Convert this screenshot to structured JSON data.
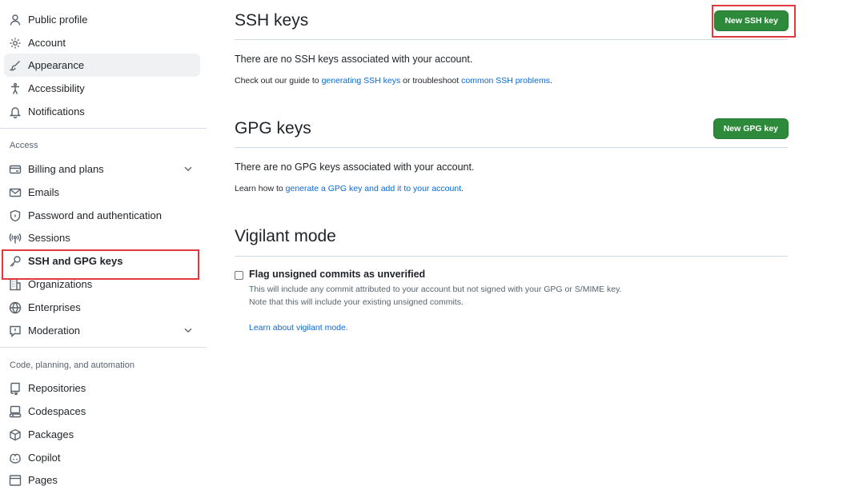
{
  "sidebar": {
    "items_top": [
      {
        "label": "Public profile",
        "icon": "person-icon"
      },
      {
        "label": "Account",
        "icon": "gear-icon"
      },
      {
        "label": "Appearance",
        "icon": "paintbrush-icon"
      },
      {
        "label": "Accessibility",
        "icon": "accessibility-icon"
      },
      {
        "label": "Notifications",
        "icon": "bell-icon"
      }
    ],
    "access_label": "Access",
    "items_access": [
      {
        "label": "Billing and plans",
        "icon": "credit-card-icon"
      },
      {
        "label": "Emails",
        "icon": "mail-icon"
      },
      {
        "label": "Password and authentication",
        "icon": "shield-lock-icon"
      },
      {
        "label": "Sessions",
        "icon": "broadcast-icon"
      },
      {
        "label": "SSH and GPG keys",
        "icon": "key-icon"
      },
      {
        "label": "Organizations",
        "icon": "organization-icon"
      },
      {
        "label": "Enterprises",
        "icon": "globe-icon"
      },
      {
        "label": "Moderation",
        "icon": "report-icon"
      }
    ],
    "code_label": "Code, planning, and automation",
    "items_code": [
      {
        "label": "Repositories",
        "icon": "repo-icon"
      },
      {
        "label": "Codespaces",
        "icon": "codespaces-icon"
      },
      {
        "label": "Packages",
        "icon": "package-icon"
      },
      {
        "label": "Copilot",
        "icon": "copilot-icon"
      },
      {
        "label": "Pages",
        "icon": "browser-icon"
      }
    ]
  },
  "ssh": {
    "title": "SSH keys",
    "button": "New SSH key",
    "empty": "There are no SSH keys associated with your account.",
    "guide_prefix": "Check out our guide to ",
    "guide_link1": "generating SSH keys",
    "guide_mid": " or troubleshoot ",
    "guide_link2": "common SSH problems",
    "guide_suffix": "."
  },
  "gpg": {
    "title": "GPG keys",
    "button": "New GPG key",
    "empty": "There are no GPG keys associated with your account.",
    "learn_prefix": "Learn how to ",
    "learn_link": "generate a GPG key and add it to your account",
    "learn_suffix": "."
  },
  "vigilant": {
    "title": "Vigilant mode",
    "checkbox_label": "Flag unsigned commits as unverified",
    "note1": "This will include any commit attributed to your account but not signed with your GPG or S/MIME key.",
    "note2": "Note that this will include your existing unsigned commits.",
    "learn_link": "Learn about vigilant mode",
    "learn_suffix": "."
  },
  "colors": {
    "accent_link": "#0969da",
    "primary_button": "#2c8a3a",
    "highlight": "#e0393e"
  }
}
